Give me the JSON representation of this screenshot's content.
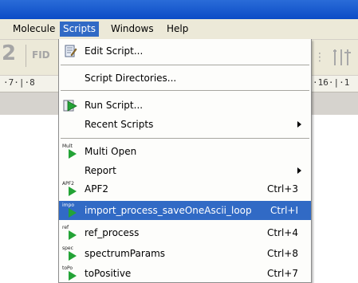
{
  "menubar": {
    "items": [
      {
        "label": "Molecule"
      },
      {
        "label": "Scripts"
      },
      {
        "label": "Windows"
      },
      {
        "label": "Help"
      }
    ]
  },
  "toolbar": {
    "big_number": "2",
    "fid_label": "FID"
  },
  "ruler": {
    "left": "·7·|·8",
    "right": "·16·|·1"
  },
  "scripts_menu": {
    "edit_script": "Edit Script...",
    "script_directories": "Script Directories...",
    "run_script": "Run Script...",
    "recent_scripts": "Recent Scripts",
    "items": [
      {
        "label": "Multi Open",
        "tag": "Mult",
        "shortcut": ""
      },
      {
        "label": "Report",
        "tag": "",
        "shortcut": ""
      },
      {
        "label": "APF2",
        "tag": "APF2",
        "shortcut": "Ctrl+3"
      },
      {
        "label": "import_process_saveOneAscii_loop",
        "tag": "impo",
        "shortcut": "Ctrl+I"
      },
      {
        "label": "ref_process",
        "tag": "ref",
        "shortcut": "Ctrl+4"
      },
      {
        "label": "spectrumParams",
        "tag": "spec",
        "shortcut": "Ctrl+8"
      },
      {
        "label": "toPositive",
        "tag": "toPo",
        "shortcut": "Ctrl+7"
      }
    ]
  },
  "colors": {
    "highlight": "#316ac5",
    "run_green": "#23a336",
    "titlebar": "#0b4bc6"
  }
}
